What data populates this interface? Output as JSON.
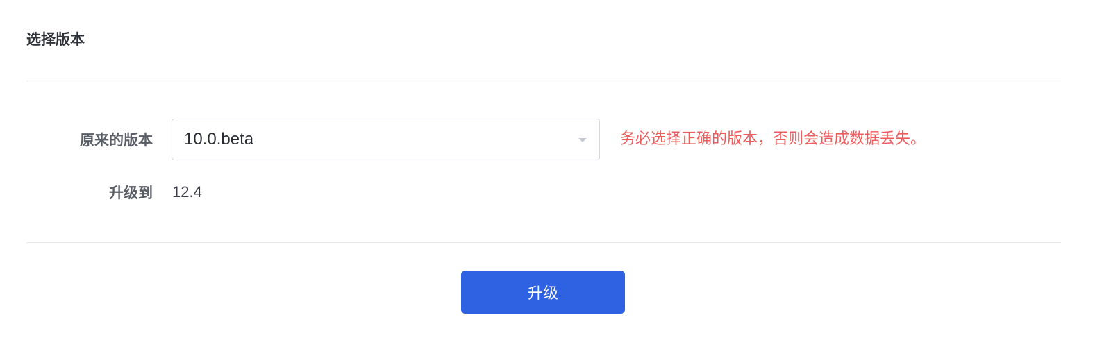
{
  "section": {
    "title": "选择版本"
  },
  "form": {
    "original_version": {
      "label": "原来的版本",
      "selected_value": "10.0.beta",
      "warning": "务必选择正确的版本，否则会造成数据丢失。"
    },
    "upgrade_to": {
      "label": "升级到",
      "value": "12.4"
    }
  },
  "actions": {
    "upgrade_label": "升级"
  },
  "colors": {
    "primary": "#2f62e3",
    "warning": "#ee5b5b",
    "divider": "#e4e6ea"
  },
  "icons": {
    "select_indicator": "chevron-down-icon"
  }
}
